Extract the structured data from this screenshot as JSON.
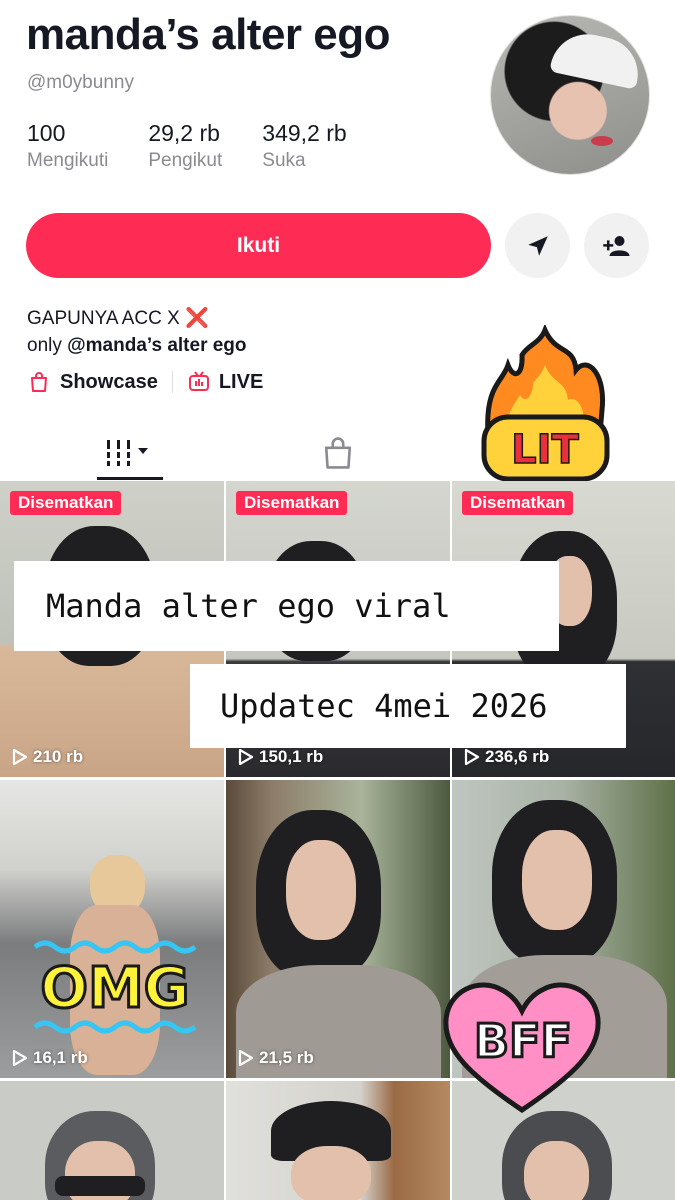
{
  "profile": {
    "name": "manda’s alter ego",
    "handle": "@m0ybunny",
    "stats": [
      {
        "value": "100",
        "label": "Mengikuti"
      },
      {
        "value": "29,2 rb",
        "label": "Pengikut"
      },
      {
        "value": "349,2 rb",
        "label": "Suka"
      }
    ]
  },
  "actions": {
    "follow_label": "Ikuti",
    "message_icon": "send-icon",
    "suggest_icon": "add-user-icon"
  },
  "bio": {
    "line1": "GAPUNYA ACC X",
    "line1_emoji": "❌",
    "line2_prefix": "only",
    "line2_mention": "@manda’s alter ego"
  },
  "links": {
    "showcase": "Showcase",
    "live": "LIVE"
  },
  "tabs": [
    {
      "icon": "grid-icon",
      "active": true
    },
    {
      "icon": "shopping-bag-icon",
      "active": false
    }
  ],
  "stickers": {
    "lit": "LIT",
    "omg": "OMG",
    "bff": "BFF"
  },
  "overlays": {
    "title": "Manda alter ego viral",
    "subtitle": "Updatec 4mei 2026"
  },
  "videos": [
    {
      "pinned_label": "Disematkan",
      "views": "210 rb"
    },
    {
      "pinned_label": "Disematkan",
      "views": "150,1 rb"
    },
    {
      "pinned_label": "Disematkan",
      "views": "236,6 rb"
    },
    {
      "views": "16,1 rb"
    },
    {
      "views": "21,5 rb"
    },
    {
      "views": ""
    },
    {
      "views": ""
    },
    {
      "views": ""
    },
    {
      "views": ""
    }
  ],
  "colors": {
    "accent": "#fe2c55",
    "text": "#161823",
    "secondary_text": "#8a8b91",
    "button_bg": "#f1f1f2"
  }
}
